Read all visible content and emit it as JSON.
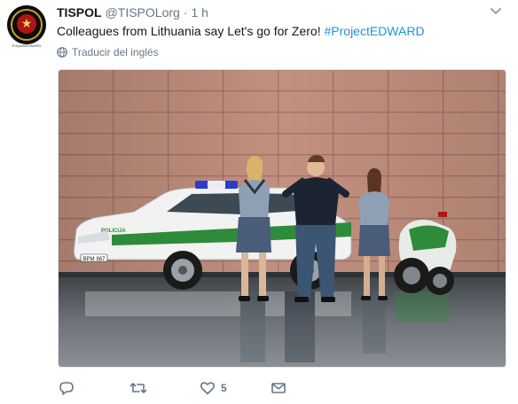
{
  "tweet": {
    "display_name": "TISPOL",
    "handle": "@TISPOLorg",
    "separator": "·",
    "time": "1 h",
    "text_plain": "Colleagues from Lithuania say Let's go for Zero! ",
    "hashtag": "#ProjectEDWARD",
    "translate_label": "Traducir del inglés",
    "avatar_caption": "ProjectEDWARD",
    "photo": {
      "car_plate": "BPM 987",
      "car_lettering": "POLICIJA"
    },
    "actions": {
      "reply_icon": "reply-icon",
      "retweet_icon": "retweet-icon",
      "like_icon": "heart-icon",
      "like_count": "5",
      "dm_icon": "envelope-icon"
    }
  },
  "colors": {
    "text": "#14171a",
    "muted": "#657786",
    "link": "#1b95e0",
    "police_green": "#2e8b3a"
  }
}
